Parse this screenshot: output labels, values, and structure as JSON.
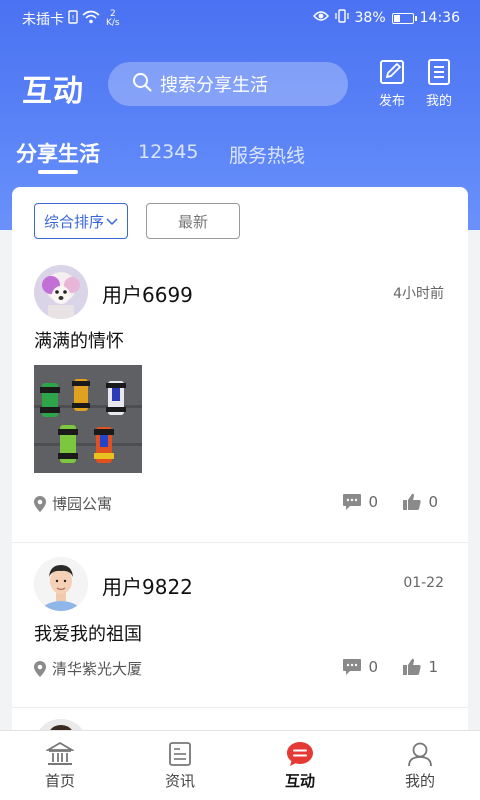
{
  "status_bar": {
    "carrier": "未插卡",
    "speed_value": "2",
    "speed_unit": "K/s",
    "battery_percent": "38%",
    "battery_level": 0.38,
    "time": "14:36"
  },
  "header": {
    "title": "互动",
    "search_placeholder": "搜索分享生活",
    "publish_label": "发布",
    "mine_label": "我的"
  },
  "tabs": [
    {
      "label": "分享生活",
      "active": true
    },
    {
      "label": "12345",
      "active": false
    },
    {
      "label": "服务热线",
      "active": false
    }
  ],
  "filters": {
    "sort_label": "综合排序",
    "newest_label": "最新"
  },
  "posts": [
    {
      "user": "用户6699",
      "time": "4小时前",
      "text": "满满的情怀",
      "location": "博园公寓",
      "comments": "0",
      "likes": "0"
    },
    {
      "user": "用户9822",
      "time": "01-22",
      "text": "我爱我的祖国",
      "location": "清华紫光大厦",
      "comments": "0",
      "likes": "1"
    }
  ],
  "bottom_nav": [
    {
      "label": "首页",
      "icon": "bank-icon",
      "active": false
    },
    {
      "label": "资讯",
      "icon": "news-icon",
      "active": false
    },
    {
      "label": "互动",
      "icon": "chat-icon",
      "active": true
    },
    {
      "label": "我的",
      "icon": "user-icon",
      "active": false
    }
  ],
  "colors": {
    "brand_blue": "#4a72f2",
    "accent_red": "#e53935"
  }
}
